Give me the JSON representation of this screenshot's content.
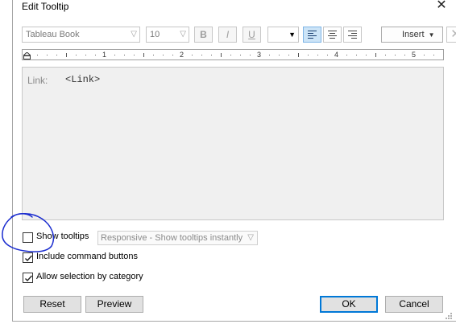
{
  "window": {
    "title": "Edit Tooltip",
    "close_glyph": "✕"
  },
  "toolbar": {
    "font_family": "Tableau Book",
    "font_size": "10",
    "bold_label": "B",
    "italic_label": "I",
    "underline_label": "U",
    "color_value": "",
    "insert_label": "Insert",
    "clear_glyph": "✕"
  },
  "ruler": {
    "labels": [
      "1",
      "2",
      "3",
      "4",
      "5"
    ]
  },
  "editor": {
    "label": "Link:",
    "field": "<Link>"
  },
  "options": {
    "show_tooltips": {
      "label": "Show tooltips",
      "checked": false
    },
    "tooltip_mode": "Responsive - Show tooltips instantly",
    "include_command_buttons": {
      "label": "Include command buttons",
      "checked": true
    },
    "allow_selection_by_category": {
      "label": "Allow selection by category",
      "checked": true
    }
  },
  "buttons": {
    "reset": "Reset",
    "preview": "Preview",
    "ok": "OK",
    "cancel": "Cancel"
  },
  "colors": {
    "accent": "#0078d7",
    "annotation": "#1a2ccf",
    "active_align": "#cce4f7"
  }
}
